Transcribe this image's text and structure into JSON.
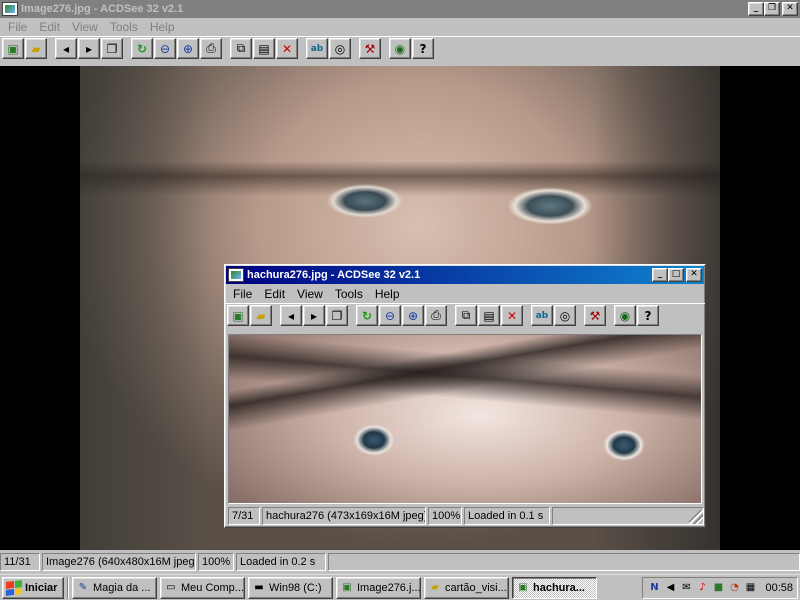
{
  "main": {
    "title": "Image276.jpg - ACDSee 32 v2.1",
    "menu": [
      "File",
      "Edit",
      "View",
      "Tools",
      "Help"
    ],
    "status": {
      "index": "11/31",
      "info": "Image276 (640x480x16M jpeg)",
      "zoom": "100%",
      "loaded": "Loaded in 0.2 s"
    }
  },
  "child": {
    "title": "hachura276.jpg - ACDSee 32 v2.1",
    "menu": [
      "File",
      "Edit",
      "View",
      "Tools",
      "Help"
    ],
    "status": {
      "index": "7/31",
      "info": "hachura276 (473x169x16M jpeg)",
      "zoom": "100%",
      "loaded": "Loaded in 0.1 s"
    }
  },
  "toolbar_icons": [
    "browse-icon",
    "open-folder-icon",
    "previous-icon",
    "next-icon",
    "slideshow-icon",
    "rotate-icon",
    "zoom-out-icon",
    "zoom-in-icon",
    "print-icon",
    "copy-icon",
    "paste-icon",
    "delete-icon",
    "text-icon",
    "wallpaper-icon",
    "tools-icon",
    "view-icon",
    "help-icon"
  ],
  "window_buttons": {
    "minimize": "_",
    "maximize": "□",
    "restore": "❐",
    "close": "✕"
  },
  "taskbar": {
    "start_label": "Iniciar",
    "tasks": [
      {
        "label": "Magia da ...",
        "icon": "document-icon"
      },
      {
        "label": "Meu Comp...",
        "icon": "computer-icon"
      },
      {
        "label": "Win98 (C:)",
        "icon": "drive-icon"
      },
      {
        "label": "Image276.j...",
        "icon": "image-icon"
      },
      {
        "label": "cartão_visi...",
        "icon": "folder-icon"
      },
      {
        "label": "hachura...",
        "icon": "image-icon"
      }
    ],
    "clock": "00:58"
  },
  "colors": {
    "active_title_start": "#000080",
    "active_title_end": "#1084d0",
    "inactive_title": "#808080",
    "face": "#c0c0c0"
  }
}
